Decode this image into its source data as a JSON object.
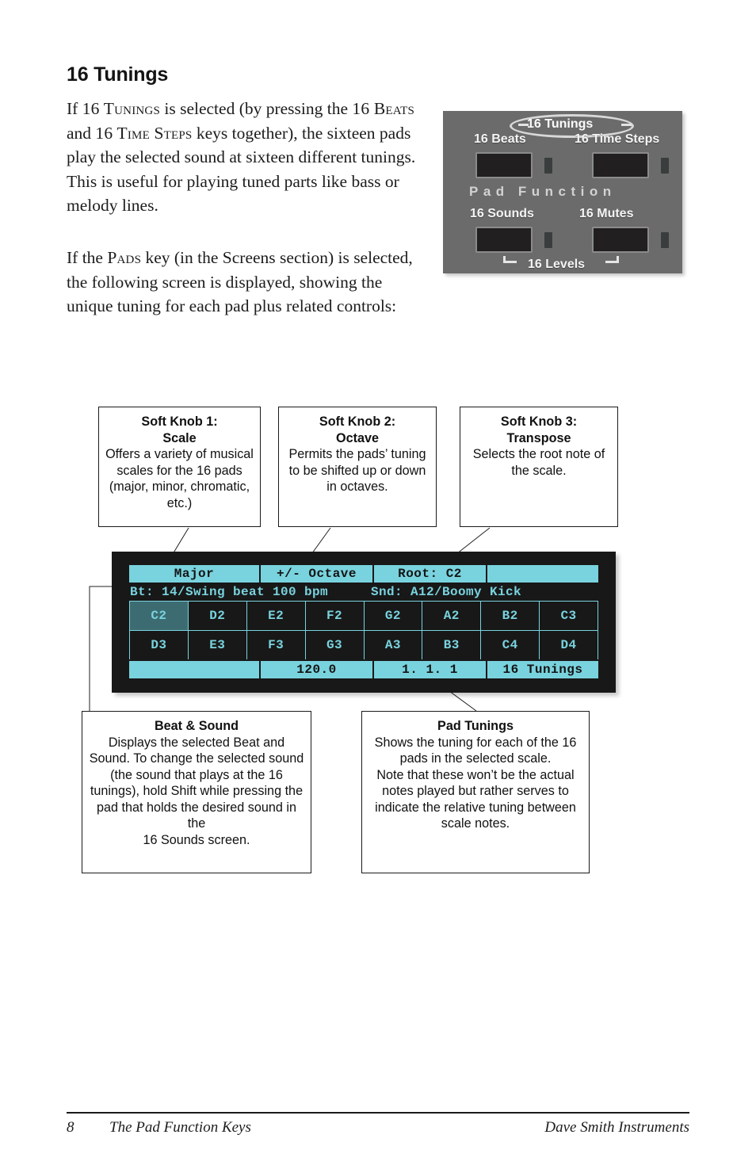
{
  "page": {
    "heading": "16 Tunings",
    "paragraph_1_parts": {
      "a": "If ",
      "sc1": "16 Tunings",
      "b": " is selected (by pressing the ",
      "sc2": "16 Beats",
      "c": " and ",
      "sc3": "16 Time Steps",
      "d": " keys together), the sixteen pads play the selected sound at sixteen different tunings. This is useful for playing tuned parts like bass or melody lines."
    },
    "paragraph_2_parts": {
      "a": "If the ",
      "sc1": "Pads",
      "b": " key (in the Screens section) is selected, the following screen is displayed, showing the unique tuning for each pad plus related controls:"
    }
  },
  "device_panel": {
    "highlight_label": "16 Tunings",
    "section_label": "Pad Function",
    "buttons": [
      {
        "label": "16 Beats"
      },
      {
        "label": "16 Time Steps"
      },
      {
        "label": "16 Sounds"
      },
      {
        "label": "16 Mutes"
      }
    ],
    "bracket_label": "16 Levels"
  },
  "callouts": {
    "knob1": {
      "title": "Soft Knob 1:\nScale",
      "body": "Offers a variety of musical scales for the 16 pads (major, minor, chromatic, etc.)"
    },
    "knob2": {
      "title": "Soft Knob 2:\nOctave",
      "body": "Permits the pads’ tuning to be shifted up or down in octaves."
    },
    "knob3": {
      "title": "Soft Knob 3:\nTranspose",
      "body": "Selects the root note of the scale."
    },
    "beat_sound": {
      "title": "Beat & Sound",
      "body": "Displays the selected Beat and Sound. To change the selected sound (the sound that plays at the 16 tunings), hold Shift while pressing the pad that holds the desired sound in the\n16 Sounds screen."
    },
    "pad_tunings": {
      "title": "Pad Tunings",
      "body": "Shows the tuning for each of the 16 pads in the selected scale.\nNote that these won’t be the actual notes played but rather serves to indicate the relative tuning between scale notes."
    }
  },
  "lcd": {
    "colors": {
      "background": "#181818",
      "foreground": "#79d3de",
      "selected_cell": "#3c6c72"
    },
    "top_row": [
      {
        "text": "Major"
      },
      {
        "text": "+/- Octave"
      },
      {
        "text": "Root: C2"
      },
      {
        "text": ""
      }
    ],
    "info_row": {
      "beat": "Bt: 14/Swing beat 100 bpm",
      "sound": "Snd: A12/Boomy Kick"
    },
    "pad_grid": {
      "row_1": [
        "C2",
        "D2",
        "E2",
        "F2",
        "G2",
        "A2",
        "B2",
        "C3"
      ],
      "row_2": [
        "D3",
        "E3",
        "F3",
        "G3",
        "A3",
        "B3",
        "C4",
        "D4"
      ],
      "selected": "C2"
    },
    "bottom_row": [
      {
        "text": ""
      },
      {
        "text": "120.0"
      },
      {
        "text": "1. 1. 1"
      },
      {
        "text": "16 Tunings"
      }
    ]
  },
  "footer": {
    "page_number": "8",
    "section": "The Pad Function Keys",
    "brand": "Dave Smith Instruments"
  }
}
